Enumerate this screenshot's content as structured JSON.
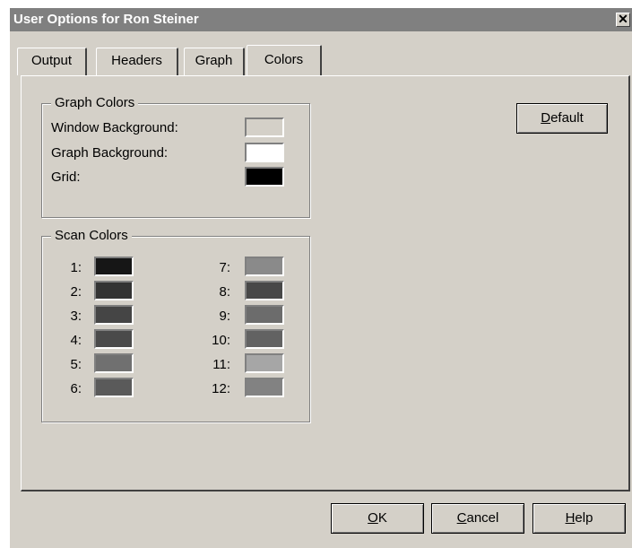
{
  "window": {
    "title": "User Options for Ron Steiner",
    "close_glyph": "✕"
  },
  "tabs": [
    {
      "label": "Output"
    },
    {
      "label": "Headers"
    },
    {
      "label": "Graph"
    },
    {
      "label": "Colors",
      "active": true
    }
  ],
  "graph_colors": {
    "legend": "Graph Colors",
    "items": [
      {
        "label": "Window Background:",
        "color": "#d4d0c8"
      },
      {
        "label": "Graph Background:",
        "color": "#ffffff"
      },
      {
        "label": "Grid:",
        "color": "#000000"
      }
    ]
  },
  "scan_colors": {
    "legend": "Scan Colors",
    "items": [
      {
        "label": "1:",
        "color": "#161616"
      },
      {
        "label": "2:",
        "color": "#333333"
      },
      {
        "label": "3:",
        "color": "#454545"
      },
      {
        "label": "4:",
        "color": "#4a4a4a"
      },
      {
        "label": "5:",
        "color": "#707070"
      },
      {
        "label": "6:",
        "color": "#5a5a5a"
      },
      {
        "label": "7:",
        "color": "#8a8a8a"
      },
      {
        "label": "8:",
        "color": "#484848"
      },
      {
        "label": "9:",
        "color": "#6c6c6c"
      },
      {
        "label": "10:",
        "color": "#626262"
      },
      {
        "label": "11:",
        "color": "#a6a6a6"
      },
      {
        "label": "12:",
        "color": "#828282"
      }
    ]
  },
  "buttons": {
    "default": {
      "hotkey": "D",
      "rest": "efault"
    },
    "ok": {
      "hotkey": "O",
      "rest": "K"
    },
    "cancel": {
      "hotkey": "C",
      "rest": "ancel"
    },
    "help": {
      "hotkey": "H",
      "rest": "elp"
    }
  }
}
